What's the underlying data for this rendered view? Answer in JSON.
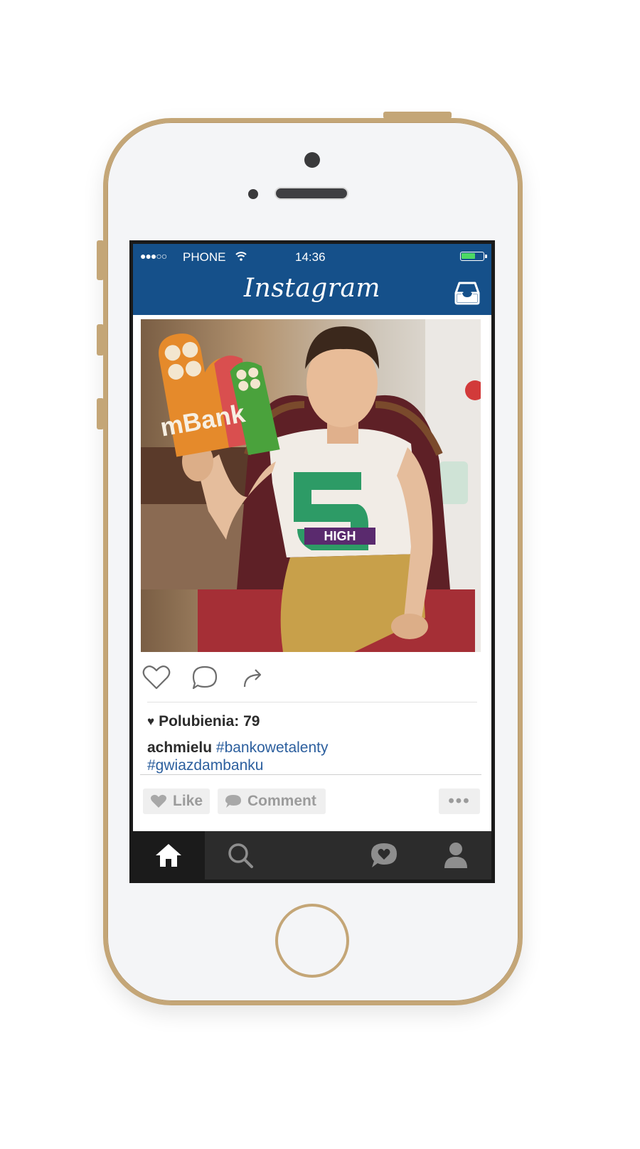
{
  "status_bar": {
    "signal": "●●●○○",
    "carrier": "PHONE",
    "time": "14:36",
    "battery_level": 0.6
  },
  "header": {
    "title": "Instagram"
  },
  "post": {
    "photo_text": {
      "sign_text": "mBank",
      "shirt_text": "HIGH"
    },
    "likes_label": "Polubienia: 79",
    "caption_user": "achmielu",
    "caption_tags": [
      "#bankowetalenty",
      "#gwiazdambanku"
    ]
  },
  "action_bar": {
    "like_label": "Like",
    "comment_label": "Comment",
    "more_label": "•••"
  },
  "tab_bar": {
    "tabs": [
      {
        "icon": "home-icon",
        "active": true
      },
      {
        "icon": "search-icon",
        "active": false
      },
      {
        "icon": "camera-icon",
        "active": false,
        "highlight": true
      },
      {
        "icon": "activity-icon",
        "active": false
      },
      {
        "icon": "profile-icon",
        "active": false
      }
    ]
  },
  "colors": {
    "header_blue": "#15508a",
    "phone_gold": "#c4a677",
    "hashtag_blue": "#2c5f9e",
    "tab_bar": "#2c2c2c"
  }
}
